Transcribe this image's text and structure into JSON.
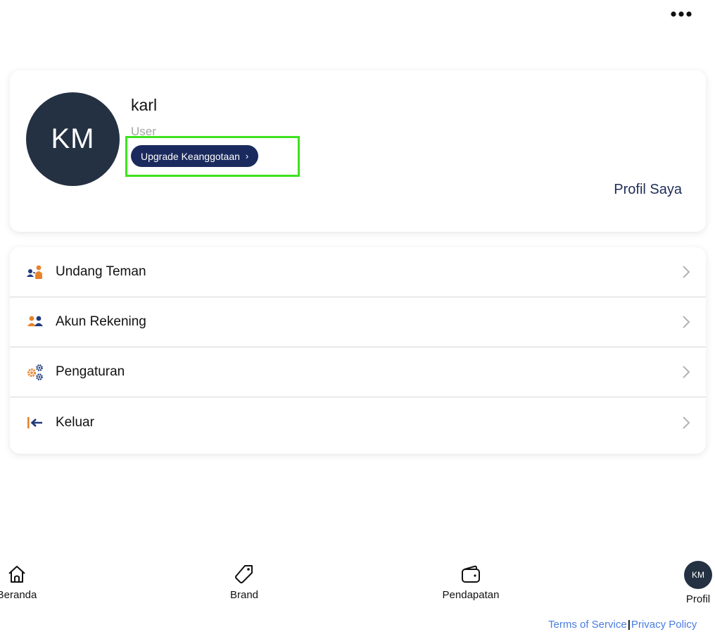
{
  "header": {
    "more_icon": "more-horizontal-icon"
  },
  "profile": {
    "initials": "KM",
    "name": "karl",
    "role": "User",
    "upgrade_label": "Upgrade Keanggotaan",
    "upgrade_chevron": "›",
    "profile_link": "Profil Saya"
  },
  "menu": {
    "items": [
      {
        "label": "Undang Teman",
        "icon": "invite-friends-icon"
      },
      {
        "label": "Akun Rekening",
        "icon": "bank-account-icon"
      },
      {
        "label": "Pengaturan",
        "icon": "settings-icon"
      },
      {
        "label": "Keluar",
        "icon": "logout-icon"
      }
    ]
  },
  "bottom_nav": {
    "items": [
      {
        "label": "Beranda",
        "icon": "home-icon"
      },
      {
        "label": "Brand",
        "icon": "tag-icon"
      },
      {
        "label": "Pendapatan",
        "icon": "wallet-icon"
      },
      {
        "label": "Profil",
        "icon": "avatar",
        "initials": "KM"
      }
    ]
  },
  "footer": {
    "terms": "Terms of Service",
    "separator": "|",
    "privacy": "Privacy Policy"
  },
  "colors": {
    "avatar_bg": "#243142",
    "upgrade_bg": "#1b2a5e",
    "highlight": "#3ee21f",
    "link_blue": "#4a7de0",
    "orange_accent": "#e8822a",
    "navy_accent": "#1f3a7a"
  }
}
